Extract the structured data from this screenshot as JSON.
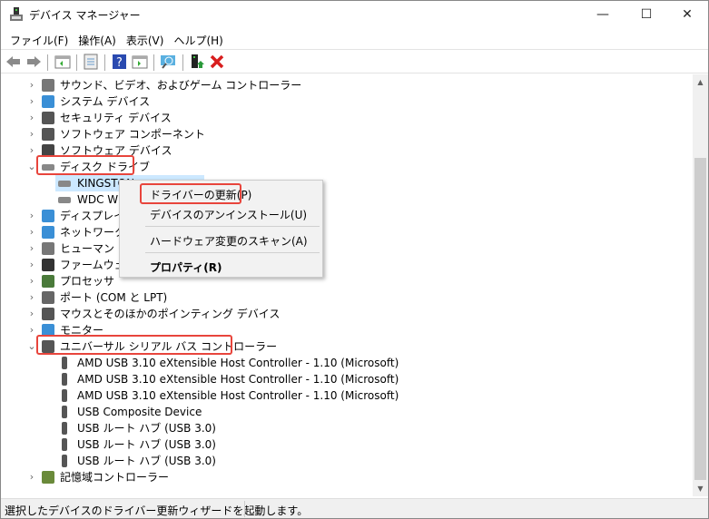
{
  "window": {
    "title": "デバイス マネージャー",
    "minimize": "—",
    "maximize": "☐",
    "close": "✕"
  },
  "menu": [
    "ファイル(F)",
    "操作(A)",
    "表示(V)",
    "ヘルプ(H)"
  ],
  "toolbar": [
    "back-icon",
    "forward-icon",
    "show-hide-console-tree-icon",
    "properties-icon",
    "help-icon",
    "action-pane-icon",
    "scan-hardware-icon",
    "update-driver-icon",
    "uninstall-icon"
  ],
  "tree": [
    {
      "label": "サウンド、ビデオ、およびゲーム コントローラー",
      "level": 0,
      "expander": "›",
      "color": "#777"
    },
    {
      "label": "システム デバイス",
      "level": 0,
      "expander": "›",
      "color": "#3a8fd6"
    },
    {
      "label": "セキュリティ デバイス",
      "level": 0,
      "expander": "›",
      "color": "#555"
    },
    {
      "label": "ソフトウェア コンポーネント",
      "level": 0,
      "expander": "›",
      "color": "#555"
    },
    {
      "label": "ソフトウェア デバイス",
      "level": 0,
      "expander": "›",
      "color": "#444"
    },
    {
      "label": "ディスク ドライブ",
      "level": 0,
      "expander": "⌄",
      "color": "#888",
      "highlight": true
    },
    {
      "label": "KINGSTON",
      "level": 1,
      "color": "#888",
      "selected": true
    },
    {
      "label": "WDC WD",
      "level": 1,
      "color": "#888"
    },
    {
      "label": "ディスプレイ ア",
      "level": 0,
      "expander": "›",
      "color": "#3a8fd6"
    },
    {
      "label": "ネットワーク ア",
      "level": 0,
      "expander": "›",
      "color": "#3a8fd6"
    },
    {
      "label": "ヒューマン イン",
      "level": 0,
      "expander": "›",
      "color": "#777"
    },
    {
      "label": "ファームウェア",
      "level": 0,
      "expander": "›",
      "color": "#333"
    },
    {
      "label": "プロセッサ",
      "level": 0,
      "expander": "›",
      "color": "#4a7a3a"
    },
    {
      "label": "ポート (COM と LPT)",
      "level": 0,
      "expander": "›",
      "color": "#666"
    },
    {
      "label": "マウスとそのほかのポインティング デバイス",
      "level": 0,
      "expander": "›",
      "color": "#555"
    },
    {
      "label": "モニター",
      "level": 0,
      "expander": "›",
      "color": "#3a8fd6"
    },
    {
      "label": "ユニバーサル シリアル バス コントローラー",
      "level": 0,
      "expander": "⌄",
      "color": "#555",
      "highlight": true
    },
    {
      "label": "AMD USB 3.10 eXtensible Host Controller - 1.10 (Microsoft)",
      "level": 1,
      "color": "#555"
    },
    {
      "label": "AMD USB 3.10 eXtensible Host Controller - 1.10 (Microsoft)",
      "level": 1,
      "color": "#555"
    },
    {
      "label": "AMD USB 3.10 eXtensible Host Controller - 1.10 (Microsoft)",
      "level": 1,
      "color": "#555"
    },
    {
      "label": "USB Composite Device",
      "level": 1,
      "color": "#555"
    },
    {
      "label": "USB ルート ハブ (USB 3.0)",
      "level": 1,
      "color": "#555"
    },
    {
      "label": "USB ルート ハブ (USB 3.0)",
      "level": 1,
      "color": "#555"
    },
    {
      "label": "USB ルート ハブ (USB 3.0)",
      "level": 1,
      "color": "#555"
    },
    {
      "label": "記憶域コントローラー",
      "level": 0,
      "expander": "›",
      "color": "#6a8a3a"
    }
  ],
  "context_menu": [
    {
      "label": "ドライバーの更新(P)",
      "highlight": true
    },
    {
      "label": "デバイスのアンインストール(U)"
    },
    {
      "label": "ハードウェア変更のスキャン(A)"
    },
    {
      "label": "プロパティ(R)",
      "bold": true
    }
  ],
  "status": "選択したデバイスのドライバー更新ウィザードを起動します。",
  "colors": {
    "highlight": "#e8453c",
    "selection": "#cce8ff"
  }
}
